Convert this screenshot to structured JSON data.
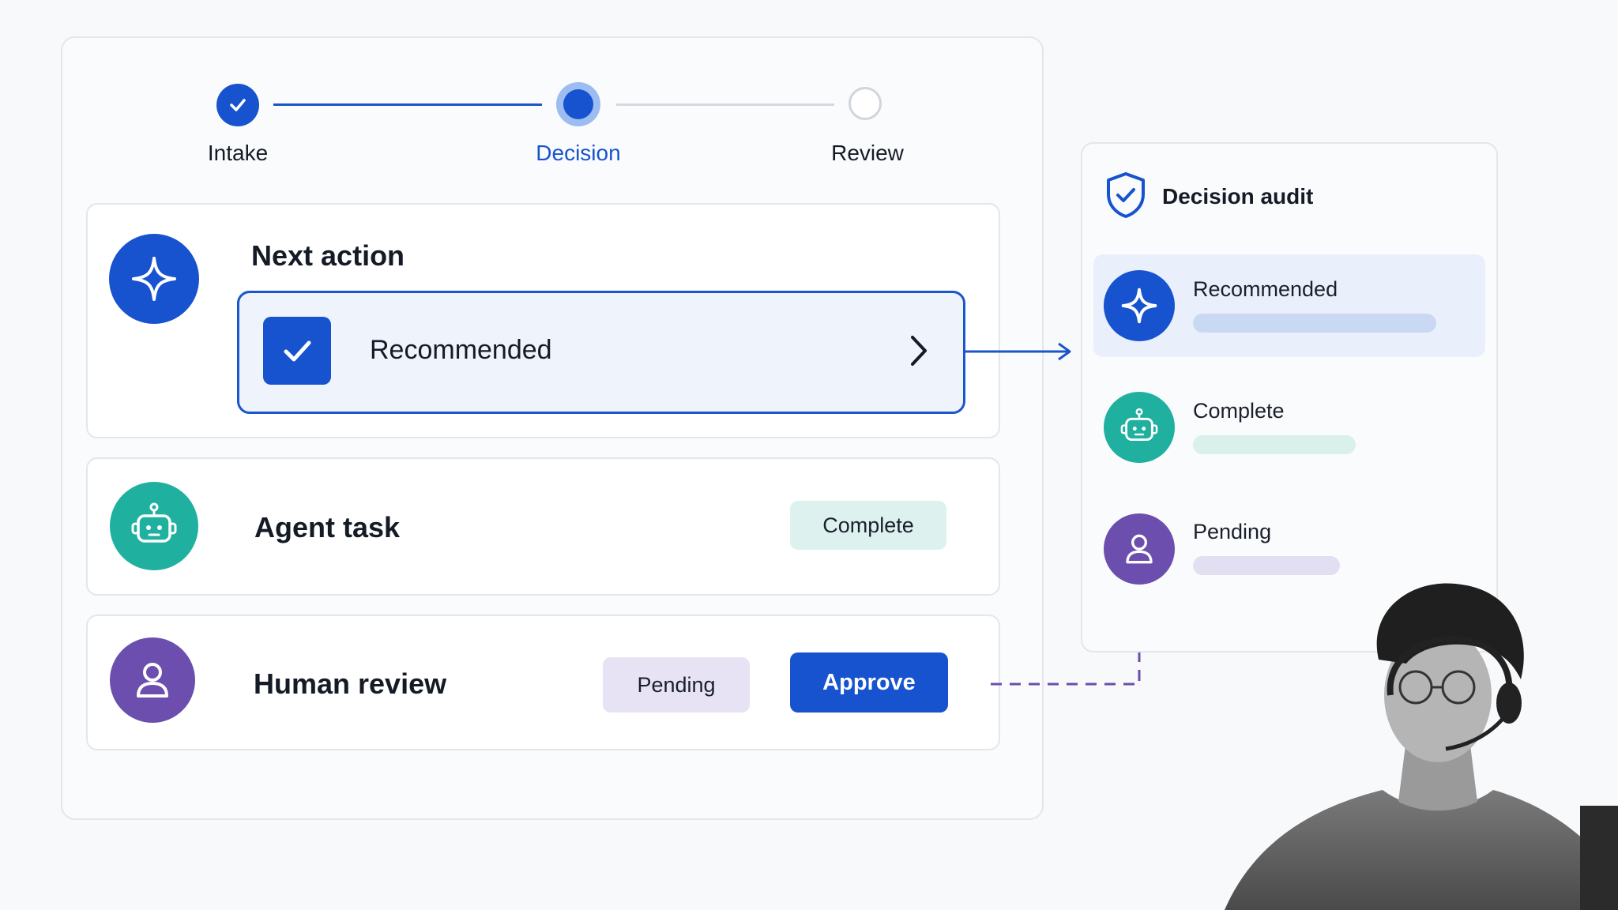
{
  "stepper": {
    "steps": [
      {
        "label": "Intake",
        "state": "done"
      },
      {
        "label": "Decision",
        "state": "current"
      },
      {
        "label": "Review",
        "state": "upcoming"
      }
    ]
  },
  "next_action": {
    "title": "Next action",
    "option_label": "Recommended"
  },
  "agent_task": {
    "title": "Agent task",
    "status": "Complete"
  },
  "human_review": {
    "title": "Human review",
    "status": "Pending",
    "approve_label": "Approve"
  },
  "audit": {
    "title": "Decision audit",
    "entries": [
      {
        "label": "Recommended",
        "icon": "sparkle-icon",
        "progress": 0.75
      },
      {
        "label": "Complete",
        "icon": "robot-icon",
        "progress": 0.5
      },
      {
        "label": "Pending",
        "icon": "person-icon",
        "progress": 0.45
      }
    ]
  },
  "colors": {
    "primary_blue": "#1753cf",
    "teal": "#1fb0a0",
    "purple": "#6b4eae",
    "complete_chip": "#ddf2ee",
    "pending_chip": "#e7e3f5"
  }
}
